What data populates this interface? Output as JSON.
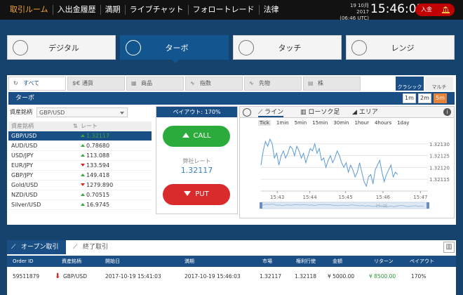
{
  "nav": {
    "items": [
      "取引ルーム",
      "入出金履歴",
      "満期",
      "ライブチャット",
      "フォロートレード",
      "法律"
    ],
    "active_index": 0
  },
  "clock": {
    "date": "19 10月 2017",
    "zone": "(06:46 UTC)",
    "time": "15:46:03"
  },
  "deposit": {
    "label": "入金",
    "icon": "bank-icon"
  },
  "modes": [
    {
      "label": "デジタル",
      "icon": "clock-icon"
    },
    {
      "label": "ターボ",
      "icon": "turbo-clock-icon",
      "active": true
    },
    {
      "label": "タッチ",
      "icon": "target-icon"
    },
    {
      "label": "レンジ",
      "icon": "trend-icon"
    }
  ],
  "categories": {
    "tabs": [
      {
        "label": "すべて",
        "icon": "refresh-icon",
        "active": true
      },
      {
        "label": "通貨",
        "icon": "currency-icon"
      },
      {
        "label": "商品",
        "icon": "goods-icon"
      },
      {
        "label": "指数",
        "icon": "index-chart-icon"
      },
      {
        "label": "先物",
        "icon": "futures-chart-icon"
      },
      {
        "label": "株",
        "icon": "stock-icon"
      }
    ],
    "view_classic": "クラシック",
    "view_multi": "マルチ"
  },
  "subbar": {
    "title": "ターボ"
  },
  "timeframes": [
    {
      "label": "1m"
    },
    {
      "label": "2m"
    },
    {
      "label": "5m",
      "active": true
    }
  ],
  "assets": {
    "select_label": "資産銘柄",
    "select_value": "GBP/USD",
    "header": {
      "name": "資産銘柄",
      "rate": "レート"
    },
    "rows": [
      {
        "name": "GBP/USD",
        "rate": "1.32117",
        "dir": "up",
        "active": true
      },
      {
        "name": "AUD/USD",
        "rate": "0.78680",
        "dir": "up"
      },
      {
        "name": "USD/JPY",
        "rate": "113.088",
        "dir": "up"
      },
      {
        "name": "EUR/JPY",
        "rate": "133.594",
        "dir": "down"
      },
      {
        "name": "GBP/JPY",
        "rate": "149.418",
        "dir": "up"
      },
      {
        "name": "Gold/USD",
        "rate": "1279.890",
        "dir": "down"
      },
      {
        "name": "NZD/USD",
        "rate": "0.70515",
        "dir": "up"
      },
      {
        "name": "Silver/USD",
        "rate": "16.9745",
        "dir": "up"
      }
    ]
  },
  "trade": {
    "payout_label": "ペイアウト: ",
    "payout_value": "170%",
    "call": "CALL",
    "put": "PUT",
    "rate_label": "opens_rate_label",
    "rate_value": "1.32117"
  },
  "trade_text": {
    "rate_label": "弊社レート"
  },
  "chart_tabs": [
    {
      "label": "ライン",
      "icon": "line-chart-icon",
      "active": true
    },
    {
      "label": "ローソク足",
      "icon": "candle-icon"
    },
    {
      "label": "エリア",
      "icon": "area-icon"
    }
  ],
  "chart_ranges": [
    {
      "label": "Tick",
      "active": true
    },
    {
      "label": "1min"
    },
    {
      "label": "5min"
    },
    {
      "label": "15min"
    },
    {
      "label": "30min"
    },
    {
      "label": "1hour"
    },
    {
      "label": "4hours"
    },
    {
      "label": "1day"
    }
  ],
  "chart_data": {
    "type": "line",
    "x_ticks": [
      "15:43",
      "15:44",
      "15:45",
      "15:46",
      "15:47"
    ],
    "y_ticks": [
      "1.32130",
      "1.32125",
      "1.32120",
      "1.32115"
    ],
    "ylim": [
      1.3211,
      1.32135
    ],
    "x_start": "15:42:45",
    "series": [
      {
        "values": [
          1.32121,
          1.32127,
          1.32131,
          1.32129,
          1.32132,
          1.3213,
          1.32124,
          1.32126,
          1.32121,
          1.32125,
          1.32127,
          1.32124,
          1.32126,
          1.32129,
          1.32128,
          1.32125,
          1.32129,
          1.32127,
          1.32124,
          1.32126,
          1.32122,
          1.32125,
          1.32128,
          1.32127,
          1.3213,
          1.32126,
          1.32128,
          1.32123,
          1.32124,
          1.3212,
          1.32123,
          1.32125,
          1.32122,
          1.32124,
          1.32127,
          1.32125,
          1.32122,
          1.3212,
          1.32122,
          1.32118,
          1.32121,
          1.32119,
          1.32116,
          1.32118,
          1.32122,
          1.32118,
          1.32114,
          1.32112,
          1.32116,
          1.32117,
          1.32113,
          1.32119,
          1.32121,
          1.32123,
          1.32118,
          1.32114,
          1.32117,
          1.32119,
          1.32121,
          1.32116,
          1.32118,
          1.32117
        ]
      }
    ],
    "navigator_x_ticks": [
      "15:46"
    ]
  },
  "orders": {
    "tab_open": "オープン取引",
    "tab_closed": "終了取引",
    "headers": [
      "Order ID",
      "資産銘柄",
      "開始日",
      "満期",
      "市場",
      "権利行使",
      "金額",
      "リターン",
      "ペイアウト"
    ],
    "rows": [
      {
        "id": "59511879",
        "dir": "down",
        "asset": "GBP/USD",
        "start": "2017-10-19 15:41:03",
        "expiry": "2017-10-19 15:46:03",
        "market": "1.32117",
        "strike": "1.32118",
        "amount": "¥ 5000.00",
        "return": "¥ 8500.00",
        "payout": "170%"
      }
    ]
  }
}
